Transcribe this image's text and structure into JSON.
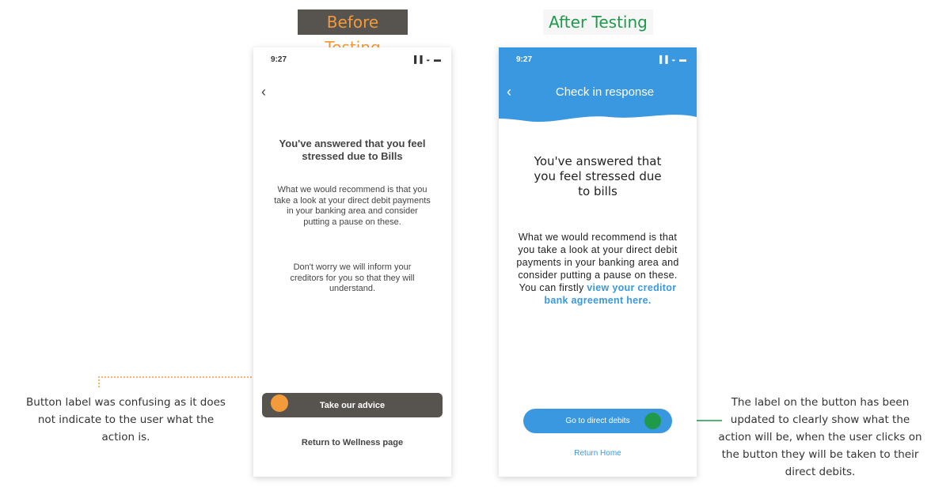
{
  "headings": {
    "before": "Before Testing",
    "after": "After Testing"
  },
  "before_phone": {
    "time": "9:27",
    "status_icons": "▐▐ ◒ ▬",
    "back_icon": "‹",
    "title": "You've answered that you feel stressed due to Bills",
    "body1": "What we would recommend is that you take a look at your direct debit payments in your banking area and consider putting a pause on these.",
    "body2": "Don't worry we will inform your creditors for you so that they will understand.",
    "button_label": "Take our advice",
    "link_label": "Return to Wellness page"
  },
  "after_phone": {
    "time": "9:27",
    "status_icons": "▐▐ ◒ ▬",
    "back_icon": "‹",
    "header_title": "Check in response",
    "question": "You've answered that you feel stressed due to bills",
    "body_prefix": "What we would recommend is that you take a look at your direct debit payments in your banking area and consider putting a pause on these. You can firstly ",
    "body_link": "view your creditor bank agreement here.",
    "button_label": "Go to direct debits",
    "home_label": "Return Home"
  },
  "annotations": {
    "left": "Button label was confusing as it does not indicate to the user what the action is.",
    "right": "The label on the button has been updated to clearly show what the action will be, when the user clicks on the button they will be taken to their direct debits."
  },
  "colors": {
    "accent_blue": "#3a98e0",
    "orange": "#f39a3a",
    "green": "#1f9a4b",
    "dark_button": "#57544f"
  }
}
